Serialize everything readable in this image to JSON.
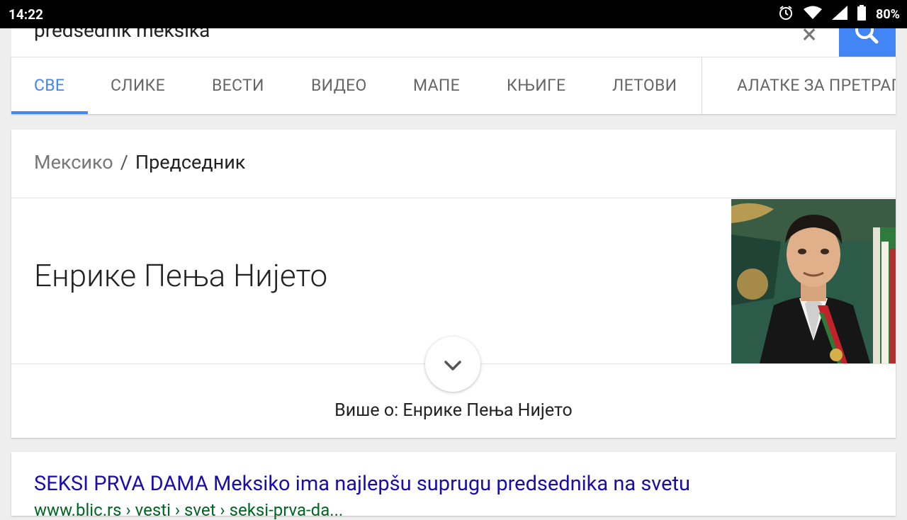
{
  "status_bar": {
    "time": "14:22",
    "battery": "80%"
  },
  "search": {
    "query": "predsednik meksika",
    "clear_icon": "close-icon",
    "search_icon": "search-icon"
  },
  "tabs": [
    {
      "label": "СВЕ",
      "active": true
    },
    {
      "label": "СЛИКЕ"
    },
    {
      "label": "ВЕСТИ"
    },
    {
      "label": "ВИДЕО"
    },
    {
      "label": "МАПЕ"
    },
    {
      "label": "КЊИГЕ"
    },
    {
      "label": "ЛЕТОВИ"
    },
    {
      "label": "АЛАТКЕ ЗА ПРЕТРАГУ"
    }
  ],
  "knowledge": {
    "breadcrumb_parent": "Мексико",
    "breadcrumb_separator": "/",
    "breadcrumb_current": "Председник",
    "answer": "Енрике Пења Нијето",
    "more_about": "Више о: Енрике Пења Нијето"
  },
  "result": {
    "title": "SEKSI PRVA DAMA Meksiko ima najlepšu suprugu predsednika na svetu",
    "url": "www.blic.rs › vesti › svet › seksi-prva-da..."
  },
  "colors": {
    "accent": "#4285f4",
    "link": "#1a0dab",
    "url": "#006621"
  }
}
